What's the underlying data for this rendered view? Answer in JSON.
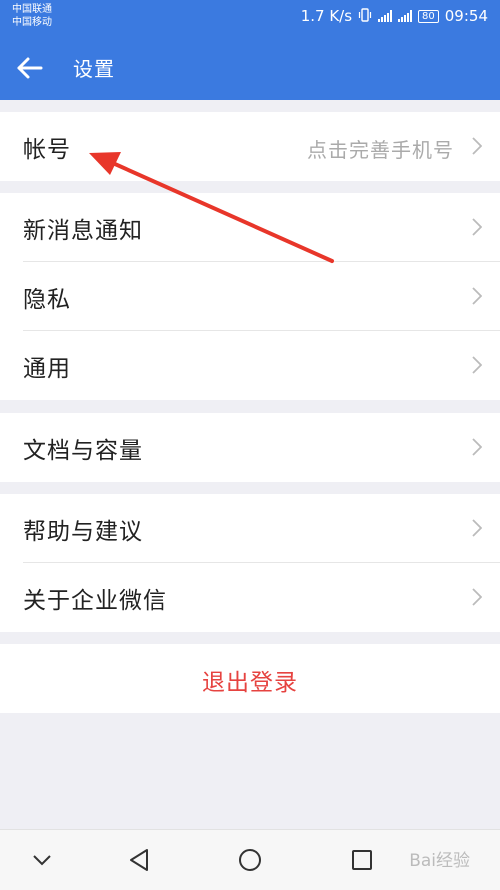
{
  "status_bar": {
    "carrier_1": "中国联通",
    "carrier_2": "中国移动",
    "net_speed": "1.7 K/s",
    "battery": "80",
    "time": "09:54"
  },
  "app_bar": {
    "title": "设置"
  },
  "settings": {
    "account": {
      "label": "帐号",
      "value": "点击完善手机号"
    },
    "notifications": {
      "label": "新消息通知"
    },
    "privacy": {
      "label": "隐私"
    },
    "general": {
      "label": "通用"
    },
    "storage": {
      "label": "文档与容量"
    },
    "help": {
      "label": "帮助与建议"
    },
    "about": {
      "label": "关于企业微信"
    }
  },
  "logout": {
    "label": "退出登录"
  },
  "watermark": {
    "text": "Bai经验"
  },
  "colors": {
    "primary": "#3b7ae0",
    "danger": "#e64340",
    "annotation_arrow": "#e8362a"
  }
}
